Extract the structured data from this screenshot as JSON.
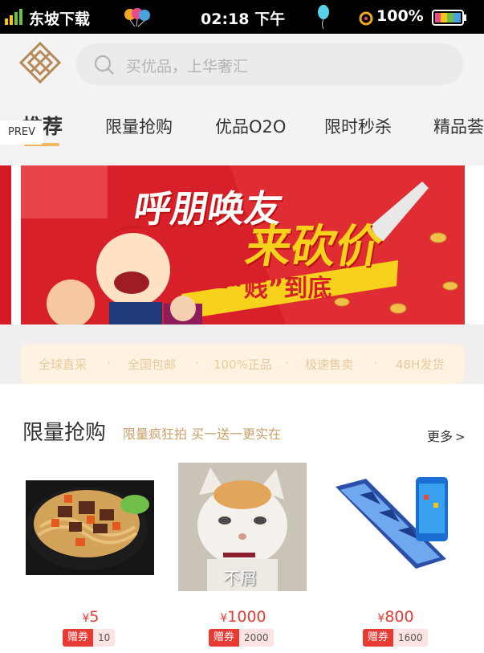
{
  "status_bar": {
    "carrier": "东坡下载",
    "time": "02:18 下午",
    "battery": "100%"
  },
  "search": {
    "placeholder": "买优品，上华奢汇"
  },
  "tabs": [
    {
      "label": "推荐",
      "active": true
    },
    {
      "label": "限量抢购"
    },
    {
      "label": "优品O2O"
    },
    {
      "label": "限时秒杀"
    },
    {
      "label": "精品荟"
    }
  ],
  "prev_label": "PREV",
  "banner": {
    "line1": "呼朋唤友",
    "line2": "来砍价",
    "line3": "一“贱”到底"
  },
  "features": [
    "全球直采",
    "全国包邮",
    "100%正品",
    "极速售卖",
    "48H发货"
  ],
  "section": {
    "title": "限量抢购",
    "subtitle": "限量疯狂拍 买一送一更实在",
    "more": "更多"
  },
  "products": [
    {
      "price": "5",
      "coupon_label": "赠券",
      "coupon_value": "10",
      "image": "noodles"
    },
    {
      "price": "1000",
      "coupon_label": "赠券",
      "coupon_value": "2000",
      "image": "cat",
      "caption": "不屑"
    },
    {
      "price": "800",
      "coupon_label": "赠券",
      "coupon_value": "1600",
      "image": "phones"
    }
  ],
  "currency": "¥",
  "colors": {
    "accent": "#f2b562",
    "price": "#e13c34",
    "banner": "#d41b24"
  }
}
